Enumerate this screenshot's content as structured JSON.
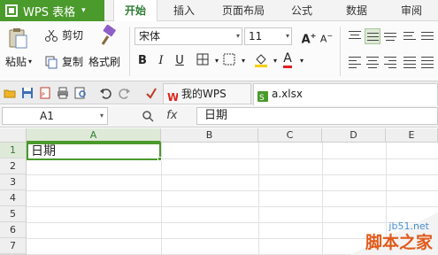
{
  "app": {
    "name": "WPS 表格",
    "brand_color": "#4a9a2c"
  },
  "menu": {
    "tabs": [
      {
        "label": "开始",
        "active": true
      },
      {
        "label": "插入",
        "active": false
      },
      {
        "label": "页面布局",
        "active": false
      },
      {
        "label": "公式",
        "active": false
      },
      {
        "label": "数据",
        "active": false
      },
      {
        "label": "审阅",
        "active": false
      }
    ]
  },
  "ribbon": {
    "paste_label": "粘贴",
    "cut_label": "剪切",
    "copy_label": "复制",
    "format_painter_label": "格式刷",
    "font_name": "宋体",
    "font_size": "11",
    "bold": "B",
    "italic": "I",
    "underline": "U",
    "font_color": "#e02020",
    "highlight_color": "#f6d000"
  },
  "tabs_bar": {
    "tabs": [
      {
        "label": "我的WPS",
        "icon": "wps-logo-icon",
        "active": false
      },
      {
        "label": "a.xlsx",
        "icon": "spreadsheet-icon",
        "active": true
      }
    ]
  },
  "formula_bar": {
    "cell_ref": "A1",
    "fx_label": "fx",
    "content": "日期"
  },
  "sheet": {
    "columns": [
      "A",
      "B",
      "C",
      "D",
      "E"
    ],
    "rows": [
      "1",
      "2",
      "3",
      "4",
      "5",
      "6",
      "7",
      "8"
    ],
    "active_cell_value": "日期"
  },
  "watermark": {
    "site": "jb51.net",
    "name": "脚本之家"
  }
}
